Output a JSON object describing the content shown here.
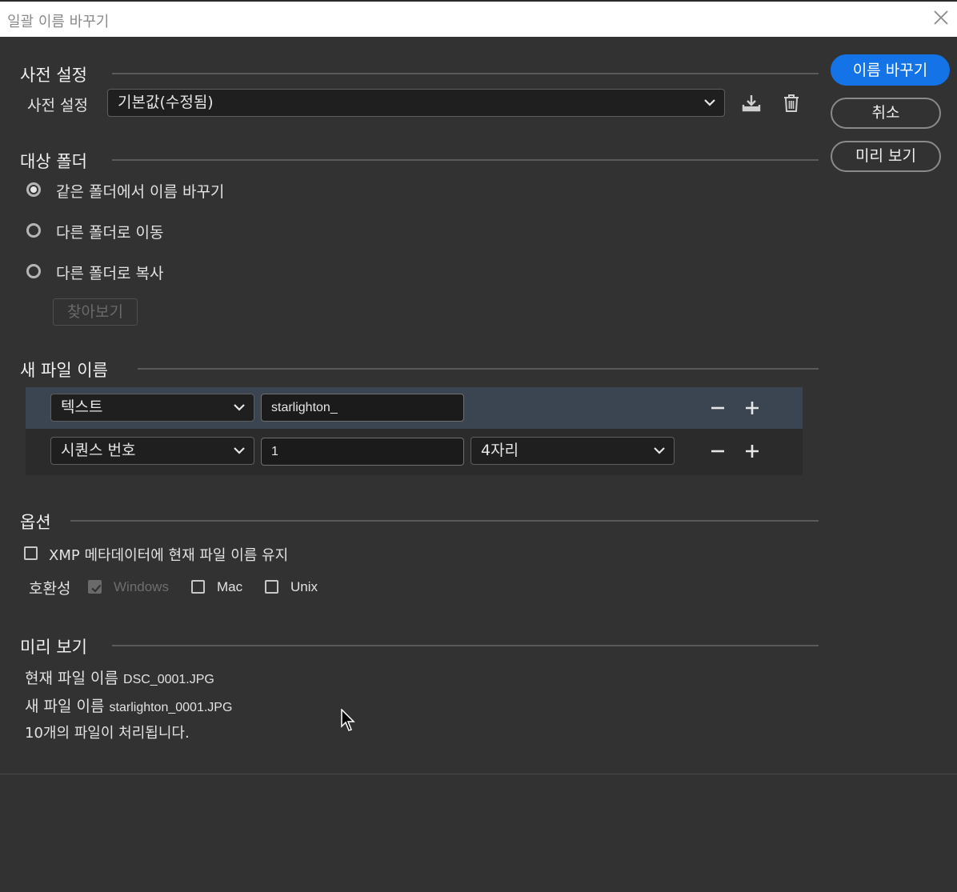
{
  "window": {
    "title": "일괄 이름 바꾸기"
  },
  "buttons": {
    "rename": "이름 바꾸기",
    "cancel": "취소",
    "preview": "미리 보기"
  },
  "preset": {
    "section_title": "사전 설정",
    "label": "사전 설정",
    "selected": "기본값(수정됨)"
  },
  "destination": {
    "section_title": "대상 폴더",
    "options": [
      "같은 폴더에서 이름 바꾸기",
      "다른 폴더로 이동",
      "다른 폴더로 복사"
    ],
    "selected_index": 0,
    "browse": "찾아보기"
  },
  "new_filename": {
    "section_title": "새 파일 이름",
    "rows": [
      {
        "type": "텍스트",
        "value": "starlighton_"
      },
      {
        "type": "시퀀스 번호",
        "value": "1",
        "digits": "4자리"
      }
    ]
  },
  "options": {
    "section_title": "옵션",
    "keep_xmp": {
      "label": "XMP 메타데이터에 현재 파일 이름 유지",
      "checked": false
    },
    "compat_label": "호환성",
    "compat": [
      {
        "label": "Windows",
        "checked": true,
        "disabled": true
      },
      {
        "label": "Mac",
        "checked": false
      },
      {
        "label": "Unix",
        "checked": false
      }
    ]
  },
  "preview": {
    "section_title": "미리 보기",
    "current_label": "현재 파일 이름",
    "current_value": "DSC_0001.JPG",
    "new_label": "새 파일 이름",
    "new_value": "starlighton_0001.JPG",
    "count_text": "10개의 파일이 처리됩니다."
  },
  "colors": {
    "accent": "#1473e6",
    "background": "#323232",
    "selected_row": "#3b4551"
  }
}
